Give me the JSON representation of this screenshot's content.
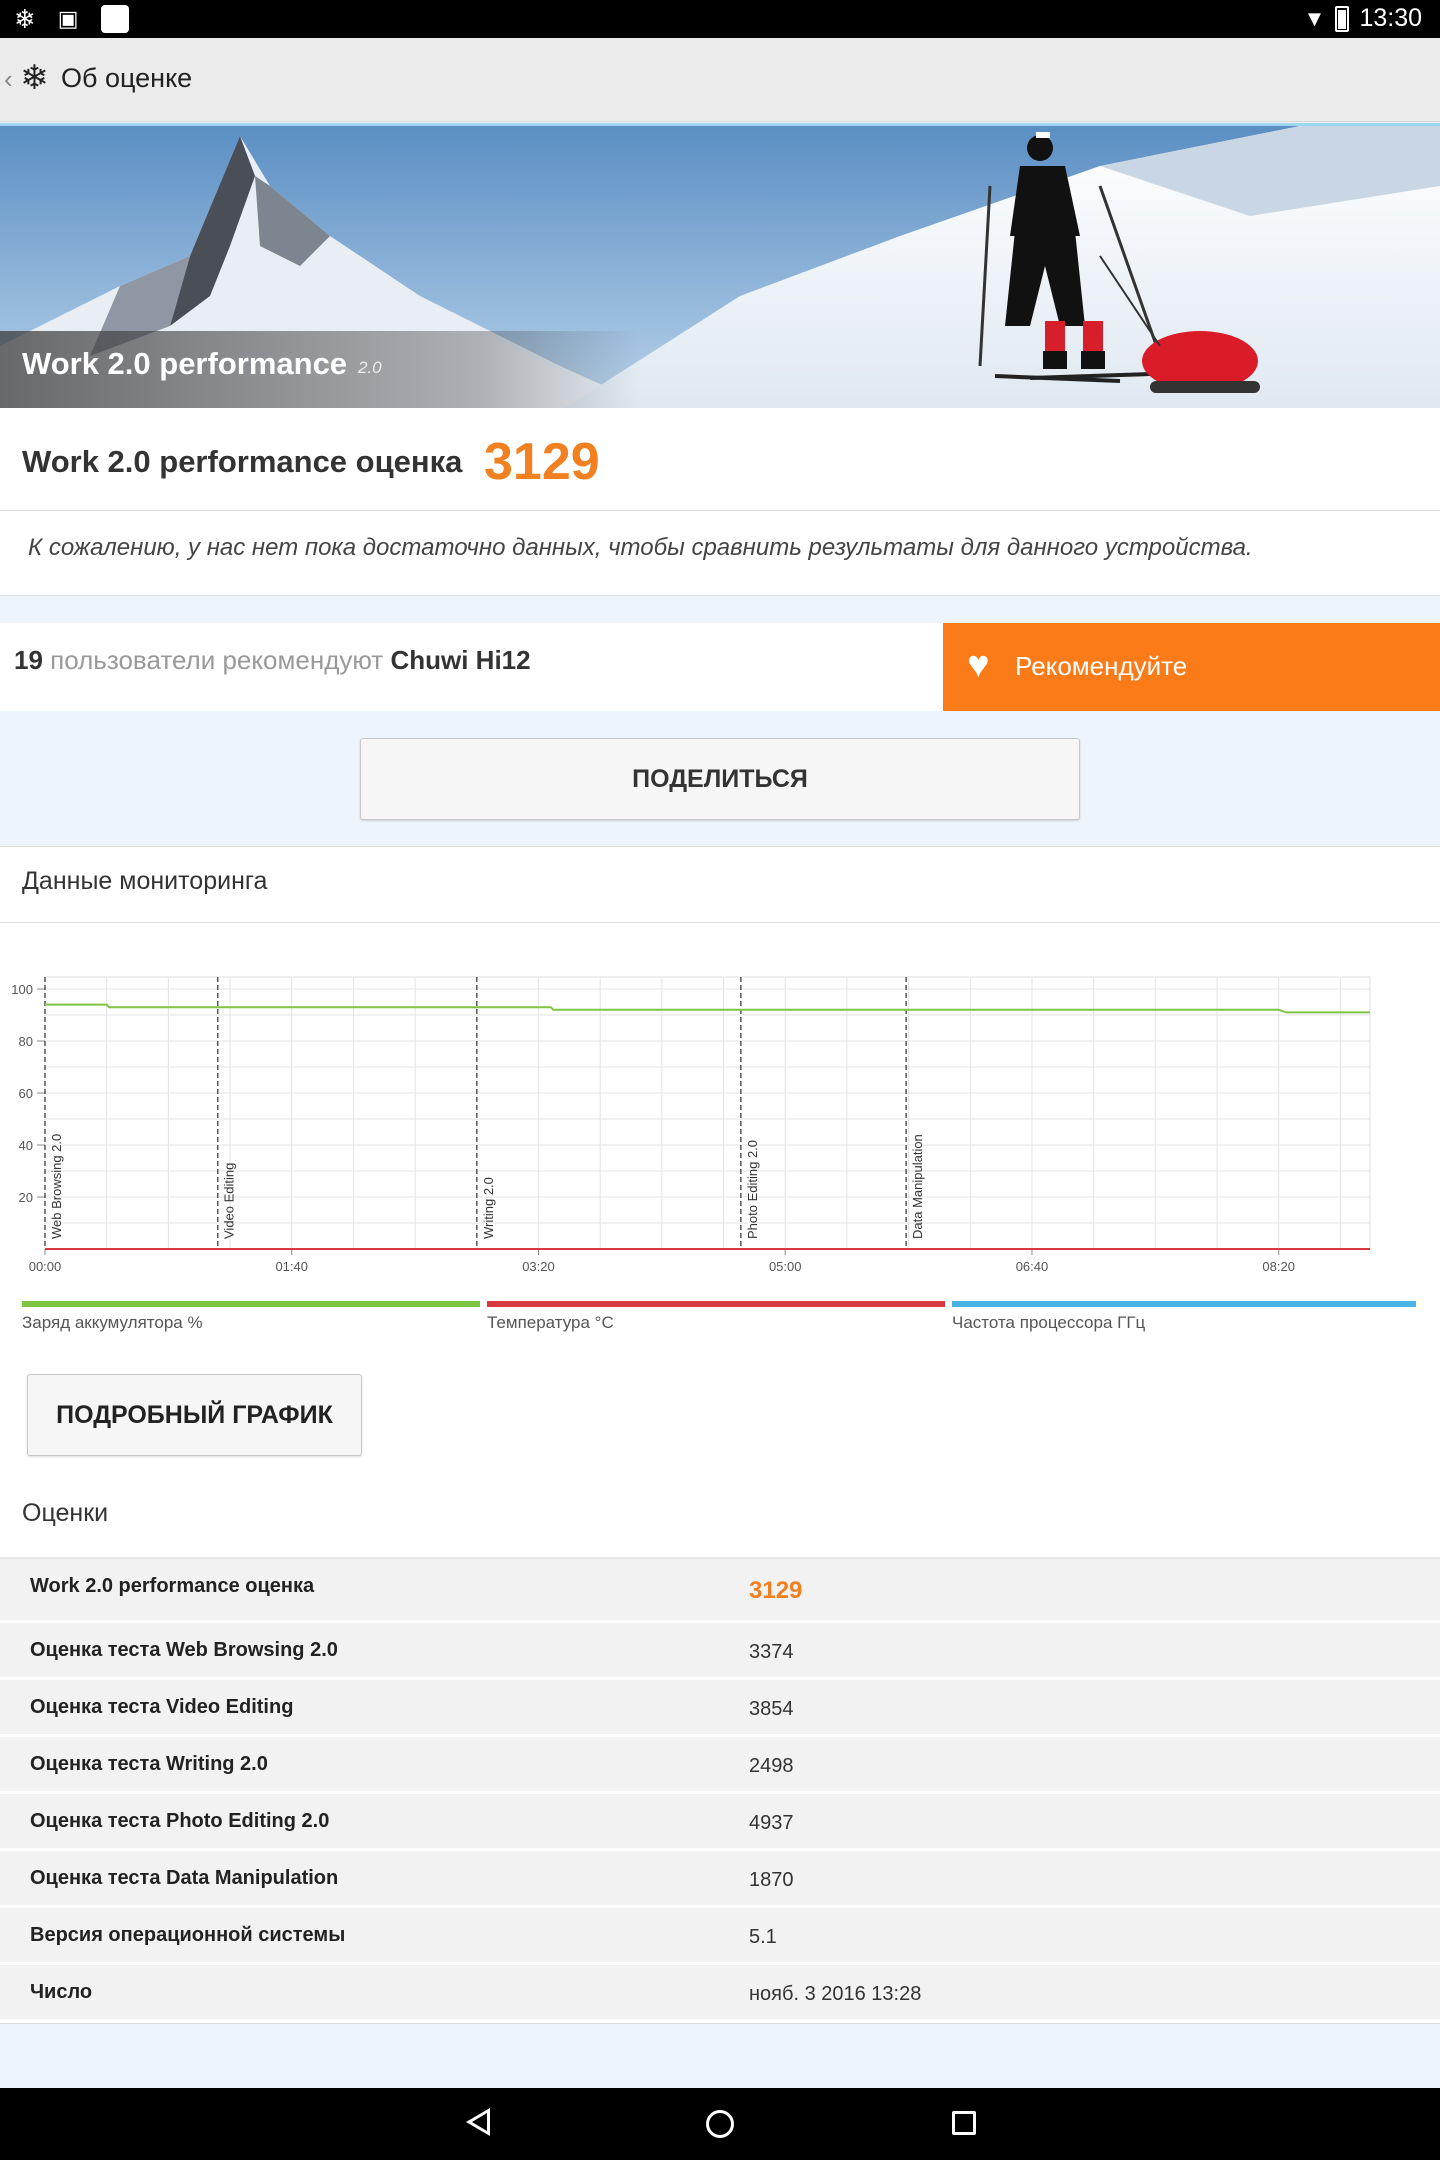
{
  "status_bar": {
    "time": "13:30",
    "icons": [
      "snowflake-icon",
      "image-icon",
      "square-icon",
      "wifi-icon",
      "battery-icon"
    ]
  },
  "action_bar": {
    "title": "Об оценке",
    "back_icon": "chevron-left-icon",
    "logo_icon": "snowflake-logo-icon"
  },
  "banner": {
    "title": "Work 2.0 performance",
    "version": "2.0"
  },
  "score": {
    "label": "Work 2.0 performance оценка",
    "value": "3129",
    "note": "К сожалению, у нас нет пока достаточно данных, чтобы сравнить результаты для данного устройства."
  },
  "recommend": {
    "count": "19",
    "text": "пользователи рекомендуют",
    "device": "Chuwi Hi12",
    "button_label": "Рекомендуйте"
  },
  "share_button": "ПОДЕЛИТЬСЯ",
  "monitoring": {
    "title": "Данные мониторинга",
    "detail_button": "ПОДРОБНЫЙ ГРАФИК",
    "legend": [
      {
        "label": "Заряд аккумулятора %",
        "color": "#7dc443"
      },
      {
        "label": "Температура °C",
        "color": "#d9383f"
      },
      {
        "label": "Частота процессора ГГц",
        "color": "#49b3e5"
      }
    ]
  },
  "chart_data": {
    "type": "line",
    "y_ticks": [
      "100",
      "80",
      "60",
      "40",
      "20"
    ],
    "ylim": [
      0,
      110
    ],
    "x_ticks": [
      "00:00",
      "01:40",
      "03:20",
      "05:00",
      "06:40",
      "08:20"
    ],
    "x_tick_minutes": [
      0,
      100,
      200,
      300,
      400,
      500
    ],
    "xlim_minutes": [
      0,
      537
    ],
    "grid": true,
    "markers": [
      {
        "label": "Web Browsing 2.0",
        "minute": 0
      },
      {
        "label": "Video Editing",
        "minute": 70
      },
      {
        "label": "Writing 2.0",
        "minute": 175
      },
      {
        "label": "Photo Editing 2.0",
        "minute": 282
      },
      {
        "label": "Data Manipulation",
        "minute": 349
      }
    ],
    "series": [
      {
        "name": "Заряд аккумулятора %",
        "x_minutes": [
          0,
          25,
          26,
          205,
          206,
          500,
          503,
          537
        ],
        "values": [
          94,
          94,
          93,
          93,
          92,
          92,
          91,
          91
        ]
      },
      {
        "name": "Температура °C",
        "x_minutes": [
          0,
          537
        ],
        "values": [
          0,
          0
        ]
      }
    ]
  },
  "scores": {
    "title": "Оценки",
    "rows": [
      {
        "key": "Work 2.0 performance оценка",
        "value": "3129"
      },
      {
        "key": "Оценка теста Web Browsing 2.0",
        "value": "3374"
      },
      {
        "key": "Оценка теста Video Editing",
        "value": "3854"
      },
      {
        "key": "Оценка теста Writing 2.0",
        "value": "2498"
      },
      {
        "key": "Оценка теста Photo Editing 2.0",
        "value": "4937"
      },
      {
        "key": "Оценка теста Data Manipulation",
        "value": "1870"
      },
      {
        "key": "Версия операционной системы",
        "value": "5.1"
      },
      {
        "key": "Число",
        "value": "нояб. 3 2016 13:28"
      }
    ]
  }
}
